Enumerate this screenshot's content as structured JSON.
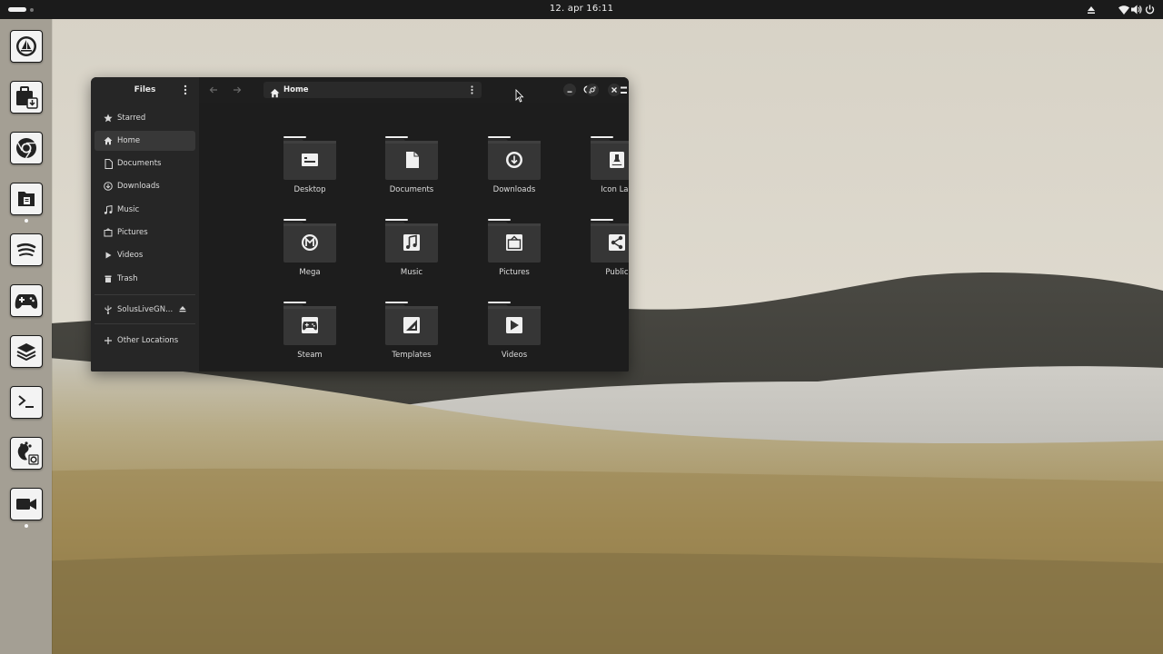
{
  "topbar": {
    "clock": "12. apr  16:11",
    "tray_icons": [
      "eject-icon",
      "wifi-icon",
      "volume-icon",
      "power-icon"
    ]
  },
  "dock": {
    "apps": [
      {
        "name": "sailboat-app-icon",
        "running": false
      },
      {
        "name": "software-center-icon",
        "running": false
      },
      {
        "name": "chrome-icon",
        "running": false
      },
      {
        "name": "files-icon",
        "running": true
      },
      {
        "name": "spotify-icon",
        "running": false
      },
      {
        "name": "gamepad-icon",
        "running": false
      },
      {
        "name": "layers-icon",
        "running": false
      },
      {
        "name": "terminal-icon",
        "running": false
      },
      {
        "name": "gnome-settings-icon",
        "running": false
      },
      {
        "name": "camera-icon",
        "running": true
      }
    ]
  },
  "window": {
    "app_title": "Files",
    "path": "Home",
    "sidebar": {
      "items": [
        {
          "label": "Starred",
          "icon": "star-icon",
          "active": false
        },
        {
          "label": "Home",
          "icon": "home-icon",
          "active": true
        },
        {
          "label": "Documents",
          "icon": "document-icon",
          "active": false
        },
        {
          "label": "Downloads",
          "icon": "download-icon",
          "active": false
        },
        {
          "label": "Music",
          "icon": "music-icon",
          "active": false
        },
        {
          "label": "Pictures",
          "icon": "picture-icon",
          "active": false
        },
        {
          "label": "Videos",
          "icon": "video-icon",
          "active": false
        },
        {
          "label": "Trash",
          "icon": "trash-icon",
          "active": false
        }
      ],
      "drive": {
        "label": "SolusLiveGN...",
        "icon": "usb-icon"
      },
      "other": {
        "label": "Other Locations",
        "icon": "plus-icon"
      }
    },
    "folders": [
      {
        "label": "Desktop",
        "emblem": "desktop"
      },
      {
        "label": "Documents",
        "emblem": "document"
      },
      {
        "label": "Downloads",
        "emblem": "download"
      },
      {
        "label": "Icon Lab",
        "emblem": "flask"
      },
      {
        "label": "Mega",
        "emblem": "mega"
      },
      {
        "label": "Music",
        "emblem": "music"
      },
      {
        "label": "Pictures",
        "emblem": "picture"
      },
      {
        "label": "Public",
        "emblem": "share"
      },
      {
        "label": "Steam",
        "emblem": "gamepad"
      },
      {
        "label": "Templates",
        "emblem": "template"
      },
      {
        "label": "Videos",
        "emblem": "play"
      }
    ]
  },
  "colors": {
    "window_bg": "#1d1d1d",
    "sidebar_bg": "#262626",
    "sidebar_active": "#383838",
    "folder_body": "#333333",
    "topbar_bg": "#1b1b1b",
    "dock_bg": "#a49f94"
  }
}
